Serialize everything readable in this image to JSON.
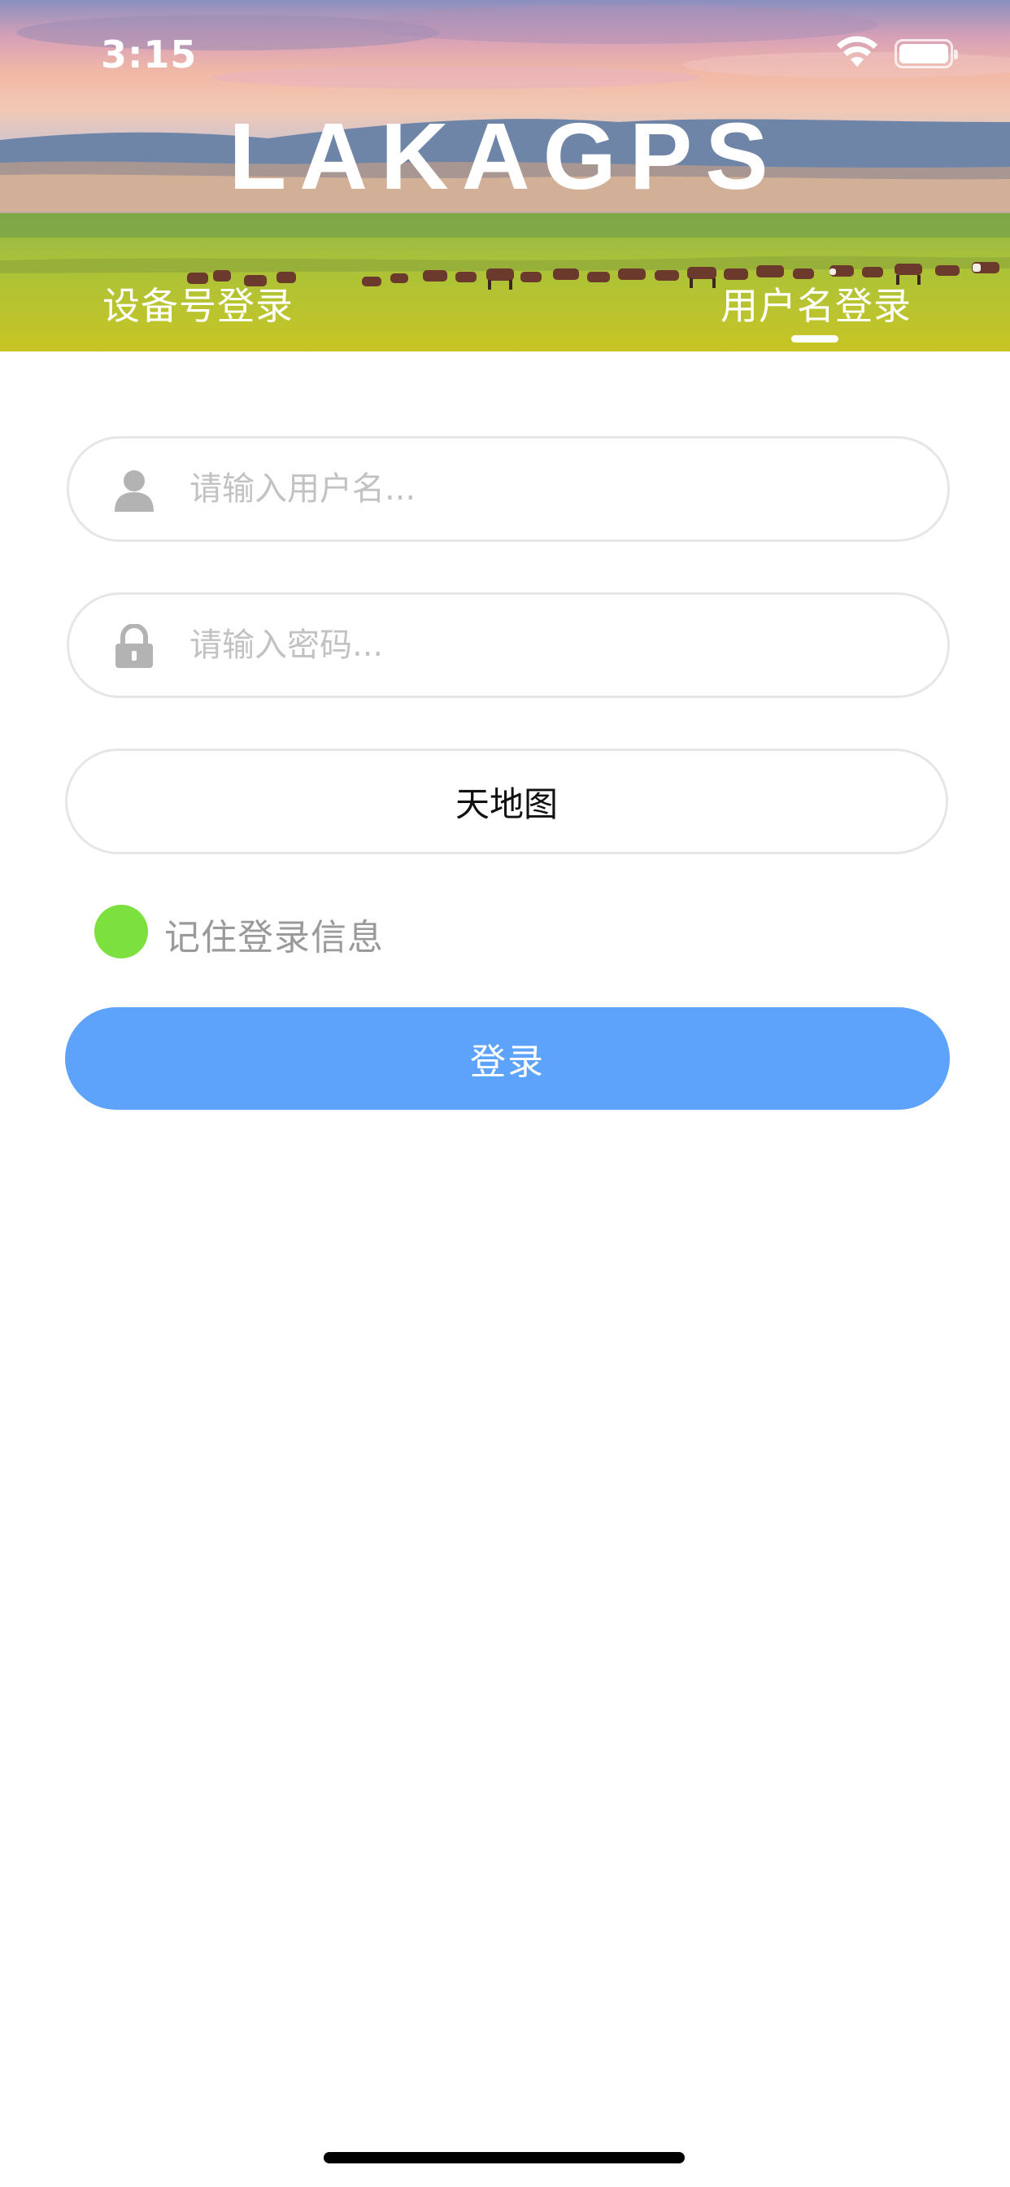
{
  "status_bar": {
    "time": "3:15",
    "wifi_icon": "wifi-icon",
    "battery_icon": "battery-icon"
  },
  "header": {
    "brand": "LAKAGPS",
    "background": "grassland-horses-photo",
    "tabs": [
      {
        "label": "设备号登录",
        "active": false
      },
      {
        "label": "用户名登录",
        "active": true
      }
    ]
  },
  "form": {
    "username": {
      "placeholder": "请输入用户名...",
      "value": "",
      "icon": "user-icon"
    },
    "password": {
      "placeholder": "请输入密码...",
      "value": "",
      "icon": "lock-icon"
    },
    "map_type": "天地图",
    "remember": {
      "label": "记住登录信息",
      "checked": true,
      "color": "#7ce03e"
    },
    "login_label": "登录",
    "login_color": "#5ea3fb"
  }
}
